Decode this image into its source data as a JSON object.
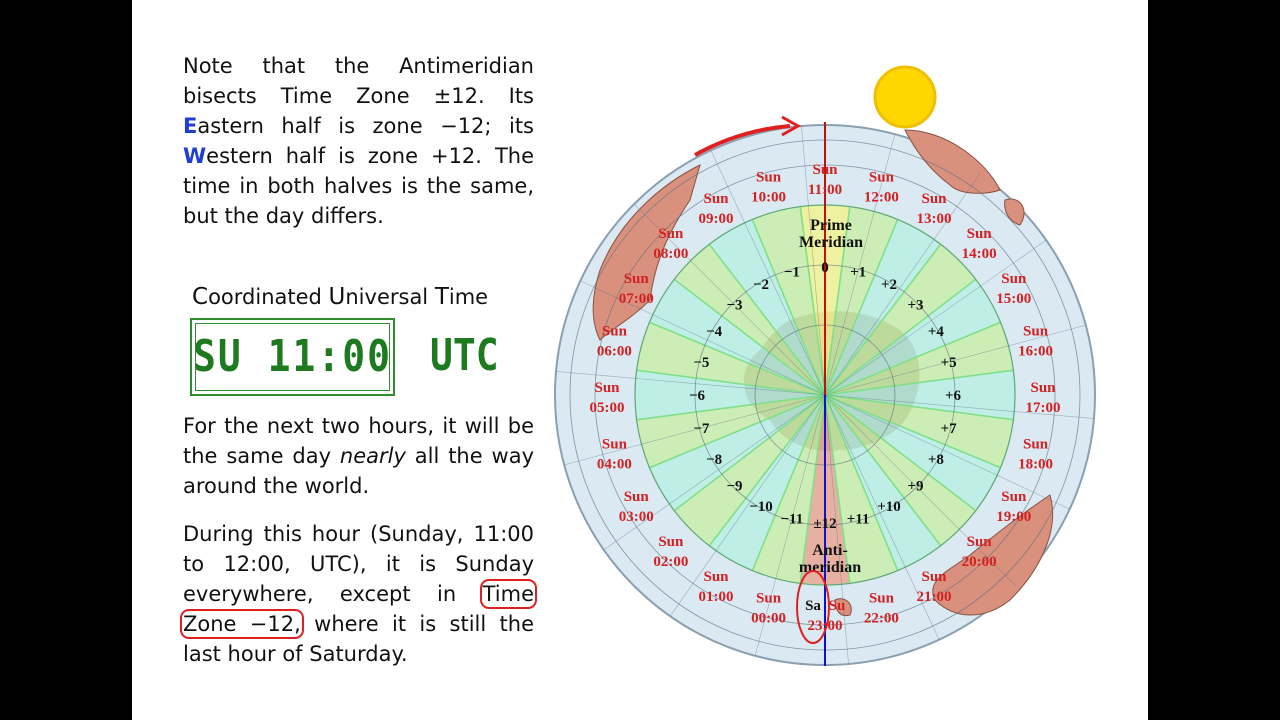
{
  "text": {
    "p1_pre": "Note that the Antimeridian bisects Time Zone ±12. Its ",
    "p1_e_letter": "E",
    "p1_mid": "astern half is zone −12; its ",
    "p1_w_letter": "W",
    "p1_post": "estern half is zone +12. The time in both halves is the same, but the day differs.",
    "utc_c": "C",
    "utc_oordinated": "oordinated ",
    "utc_u": "U",
    "utc_niversal": "niversal ",
    "utc_t": "T",
    "utc_ime": "ime",
    "clock_value": "SU 11:00",
    "clock_unit": "UTC",
    "p2_pre": "For the next two hours, it will be the same day ",
    "p2_em": "nearly",
    "p2_post": " all the way around the world.",
    "p3_pre": "During this hour (Sunday, 11:00 to 12:00, UTC), it is Sunday everywhere, except in ",
    "p3_boxed": "Time Zone −12,",
    "p3_post": " where it is still the last hour of Saturday."
  },
  "map": {
    "prime_meridian_label": [
      "Prime",
      "Meridian"
    ],
    "antimeridian_label": [
      "Anti-",
      "meridian"
    ],
    "zone_labels": [
      "0",
      "+1",
      "+2",
      "+3",
      "+4",
      "+5",
      "+6",
      "+7",
      "+8",
      "+9",
      "+10",
      "+11",
      "±12",
      "−11",
      "−10",
      "−9",
      "−8",
      "−7",
      "−6",
      "−5",
      "−4",
      "−3",
      "−2",
      "−1"
    ],
    "time_labels": [
      {
        "day": "Sun",
        "time": "11:00"
      },
      {
        "day": "Sun",
        "time": "12:00"
      },
      {
        "day": "Sun",
        "time": "13:00"
      },
      {
        "day": "Sun",
        "time": "14:00"
      },
      {
        "day": "Sun",
        "time": "15:00"
      },
      {
        "day": "Sun",
        "time": "16:00"
      },
      {
        "day": "Sun",
        "time": "17:00"
      },
      {
        "day": "Sun",
        "time": "18:00"
      },
      {
        "day": "Sun",
        "time": "19:00"
      },
      {
        "day": "Sun",
        "time": "20:00"
      },
      {
        "day": "Sun",
        "time": "21:00"
      },
      {
        "day": "Sun",
        "time": "22:00"
      },
      {
        "day": "Sa",
        "day2": "Su",
        "time": "23:00"
      },
      {
        "day": "Sun",
        "time": "00:00"
      },
      {
        "day": "Sun",
        "time": "01:00"
      },
      {
        "day": "Sun",
        "time": "02:00"
      },
      {
        "day": "Sun",
        "time": "03:00"
      },
      {
        "day": "Sun",
        "time": "04:00"
      },
      {
        "day": "Sun",
        "time": "05:00"
      },
      {
        "day": "Sun",
        "time": "06:00"
      },
      {
        "day": "Sun",
        "time": "07:00"
      },
      {
        "day": "Sun",
        "time": "08:00"
      },
      {
        "day": "Sun",
        "time": "09:00"
      },
      {
        "day": "Sun",
        "time": "10:00"
      }
    ],
    "colors": {
      "zone_a": "#c8ee9c",
      "zone_b": "#b4efe0",
      "prime": "#f3f28a",
      "anti": "#e8a28c",
      "ocean": "#dbe9f3",
      "land": "#d9917e",
      "antarctica": "#a9a99a",
      "time_text": "#d42020",
      "arrow": "#e02020",
      "prime_line": "#c01010",
      "anti_line": "#1010d0",
      "sun": "#ffd700"
    }
  }
}
